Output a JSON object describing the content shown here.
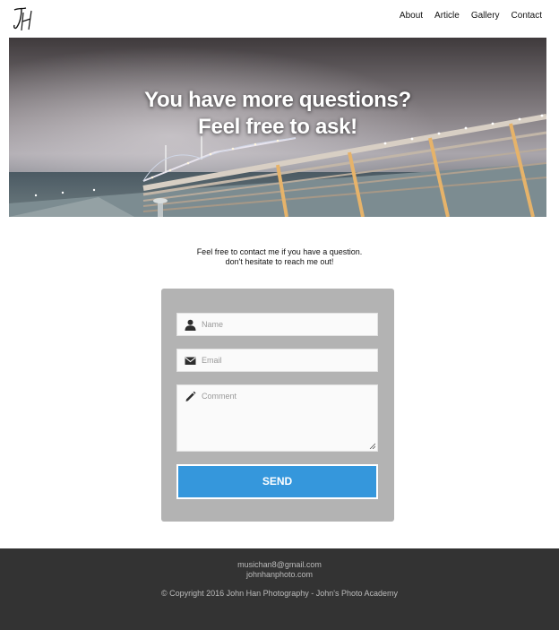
{
  "header": {
    "logo_alt": "JH",
    "nav": [
      "About",
      "Article",
      "Gallery",
      "Contact"
    ]
  },
  "hero": {
    "title_line1": "You have more questions?",
    "title_line2": "Feel free to ask!"
  },
  "intro": {
    "line1": "Feel free to contact me if you have a question.",
    "line2": "don't hesitate to reach me out!"
  },
  "form": {
    "name_placeholder": "Name",
    "email_placeholder": "Email",
    "comment_placeholder": "Comment",
    "send_label": "SEND"
  },
  "footer": {
    "email": "musichan8@gmail.com",
    "website": "johnhanphoto.com",
    "copyright": "© Copyright 2016 John Han Photography - John's Photo Academy"
  },
  "colors": {
    "accent": "#3597dc",
    "form_bg": "#b3b3b3",
    "footer_bg": "#333333"
  }
}
